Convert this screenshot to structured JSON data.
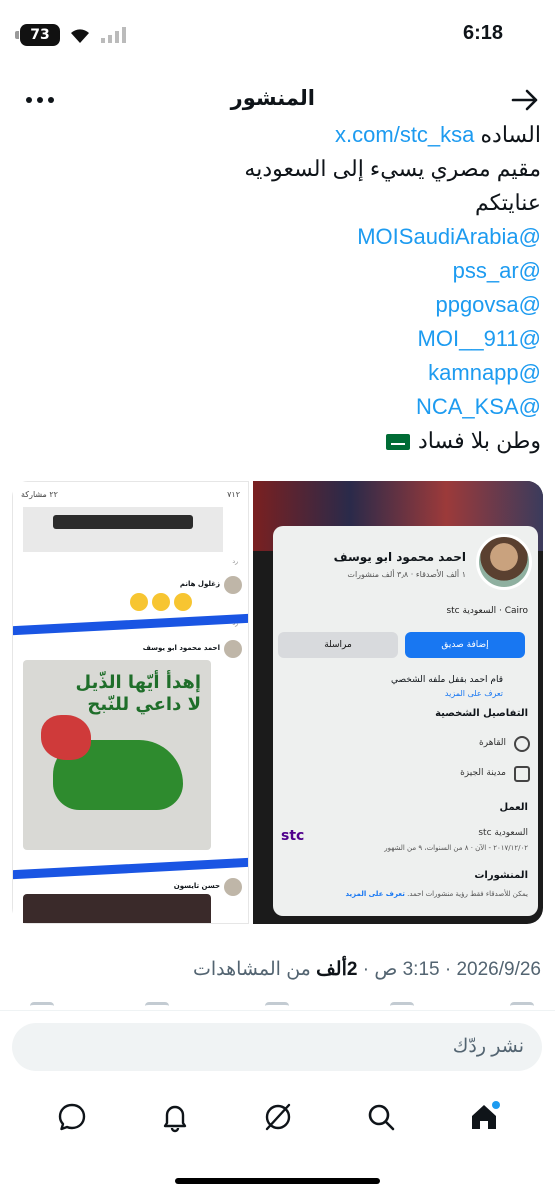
{
  "status_bar": {
    "battery": "73",
    "time": "6:18"
  },
  "header": {
    "title": "المنشور"
  },
  "post": {
    "lines": [
      {
        "text": "الساده ",
        "link": "x.com/stc_ksa"
      },
      {
        "text": "مقيم مصري يسيء إلى السعوديه"
      },
      {
        "text": "عنايتكم"
      },
      {
        "link": "@MOISaudiArabia"
      },
      {
        "link": "@pss_ar"
      },
      {
        "link": "@ppgovsa"
      },
      {
        "link": "@MOI__911"
      },
      {
        "link": "@kamnapp"
      },
      {
        "link": "@NCA_KSA"
      },
      {
        "text": "وطن بلا فساد"
      }
    ]
  },
  "media_left": {
    "name": "احمد محمود ابو يوسف",
    "stats": "١ ألف الأصدقاء · ٣٫٨ ألف منشورات",
    "location_line": "Cairo · السعودية stc",
    "add_friend": "إضافة صديق",
    "message": "مراسلة",
    "lock_text": "قام احمد بقفل ملفه الشخصي",
    "learn_more": "تعرف على المزيد",
    "details_title": "التفاصيل الشخصية",
    "city1": "القاهرة",
    "city2": "مدينة الجيزة",
    "work_title": "العمل",
    "work_company": "السعودية stc",
    "work_dates": "٢٠١٧/١٢/٠٢ - الآن · ٨ من السنوات، ٩ من الشهور",
    "posts_title": "المنشورات",
    "posts_note": "يمكن للأصدقاء فقط رؤية منشورات احمد.",
    "posts_more": "تعرف على المزيد"
  },
  "media_right": {
    "likes": "٧١٢",
    "shares": "٢٢ مشاركة",
    "comment1_name": "زغلول هانم",
    "comment2_name": "احمد محمود ابو يوسف",
    "comment3_name": "حسن تايسون",
    "dog_caption_line1": "إهدأ أيّها الذّيل",
    "dog_caption_line2": "لا داعي للنّبح",
    "reply": "رد"
  },
  "timestamp": {
    "prefix": "من المشاهدات",
    "views": "2ألف",
    "rest": "2026/9/26 · 3:15 ص · "
  },
  "composer": {
    "placeholder": "نشر ردّك"
  },
  "nav": [
    "home-icon",
    "search-icon",
    "grok-icon",
    "notifications-icon",
    "messages-icon"
  ],
  "colors": {
    "link": "#1d9bf0",
    "text": "#0f1419",
    "muted": "#536471",
    "fb_blue": "#1877f2"
  }
}
